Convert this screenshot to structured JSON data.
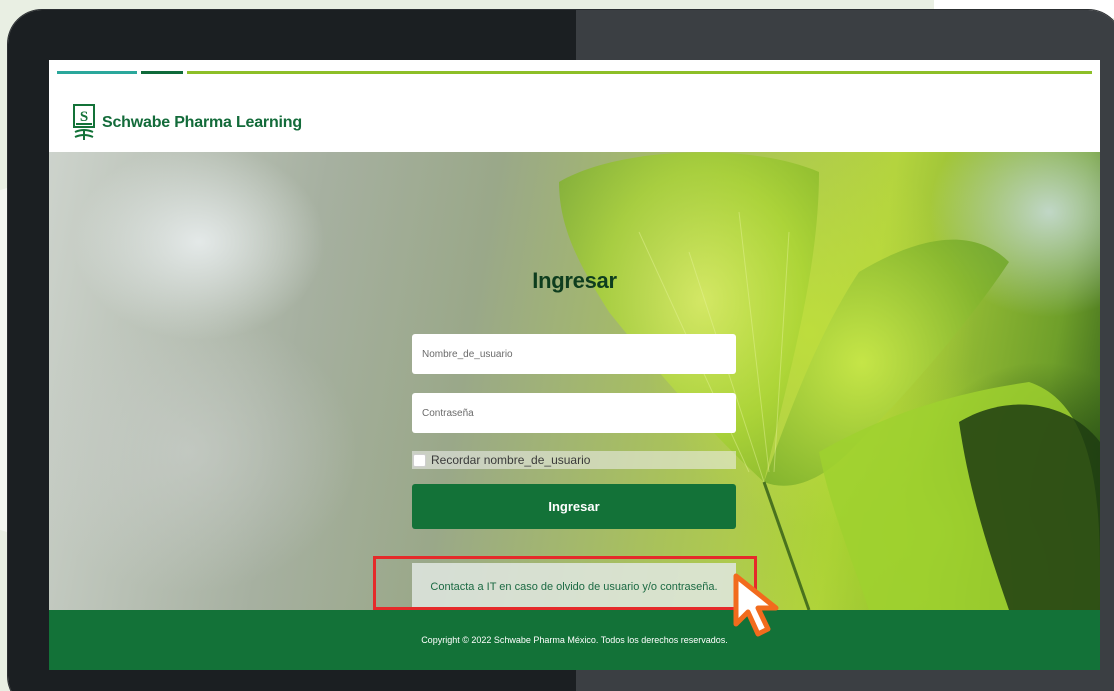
{
  "brand": {
    "name": "Schwabe Pharma Learning",
    "logo_icon": "schwabe-logo-icon"
  },
  "login": {
    "title": "Ingresar",
    "username_placeholder": "Nombre_de_usuario",
    "password_placeholder": "Contraseña",
    "remember_label": "Recordar nombre_de_usuario",
    "submit_label": "Ingresar",
    "contact_text": "Contacta a IT en caso de olvido de usuario y/o contraseña."
  },
  "footer": {
    "copyright": "Copyright © 2022 Schwabe Pharma México. Todos los derechos reservados."
  },
  "colors": {
    "primary_green": "#137238",
    "brand_green": "#136b3a",
    "highlight_red": "#e52a2a",
    "line_teal": "#2aa79b",
    "line_lime": "#8dbf28"
  },
  "annotation": {
    "cursor_icon": "pointer-cursor-icon",
    "highlight_target": "contact-it-link"
  }
}
